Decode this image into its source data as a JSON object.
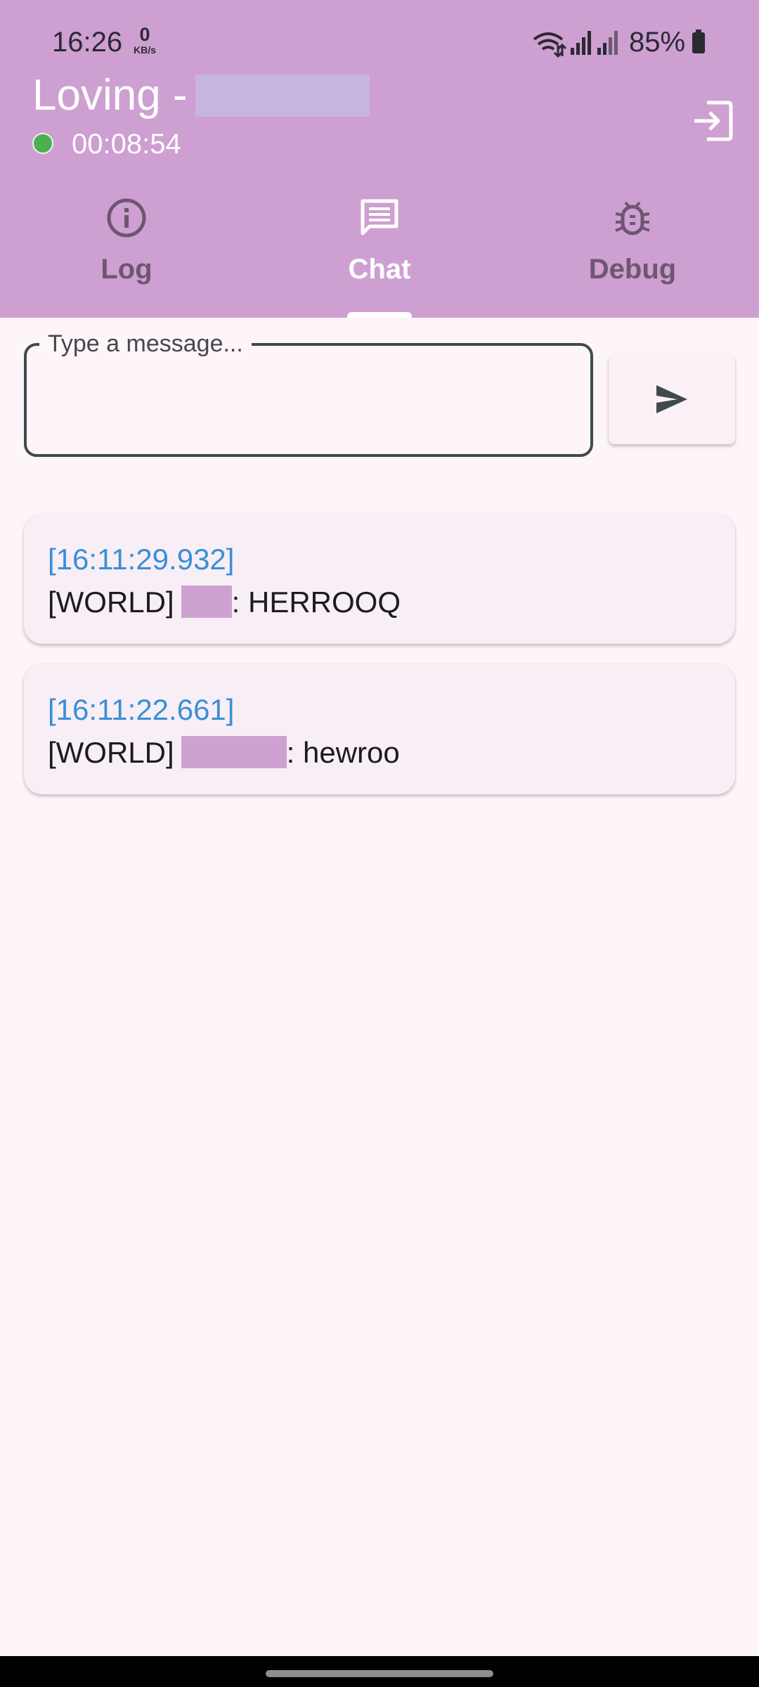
{
  "status_bar": {
    "time": "16:26",
    "speed_value": "0",
    "speed_unit": "KB/s",
    "battery_percent": "85%"
  },
  "header": {
    "title": "Loving -",
    "elapsed": "00:08:54",
    "status_color": "#4CAF50"
  },
  "tabs": [
    {
      "label": "Log",
      "icon": "info-icon",
      "selected": false
    },
    {
      "label": "Chat",
      "icon": "chat-icon",
      "selected": true
    },
    {
      "label": "Debug",
      "icon": "bug-icon",
      "selected": false
    }
  ],
  "composer": {
    "placeholder": "Type a message...",
    "value": "",
    "send_icon": "send-icon"
  },
  "messages": [
    {
      "timestamp": "[16:11:29.932]",
      "channel": "[WORLD]",
      "text": ": HERROOQ"
    },
    {
      "timestamp": "[16:11:22.661]",
      "channel": "[WORLD]",
      "text": ": hewroo"
    }
  ],
  "colors": {
    "app_bar": "#CE9FD1",
    "background": "#FEF5F8",
    "timestamp": "#3A8FD6",
    "tab_selected": "#FFFFFF",
    "tab_unselected": "#6E5670"
  }
}
